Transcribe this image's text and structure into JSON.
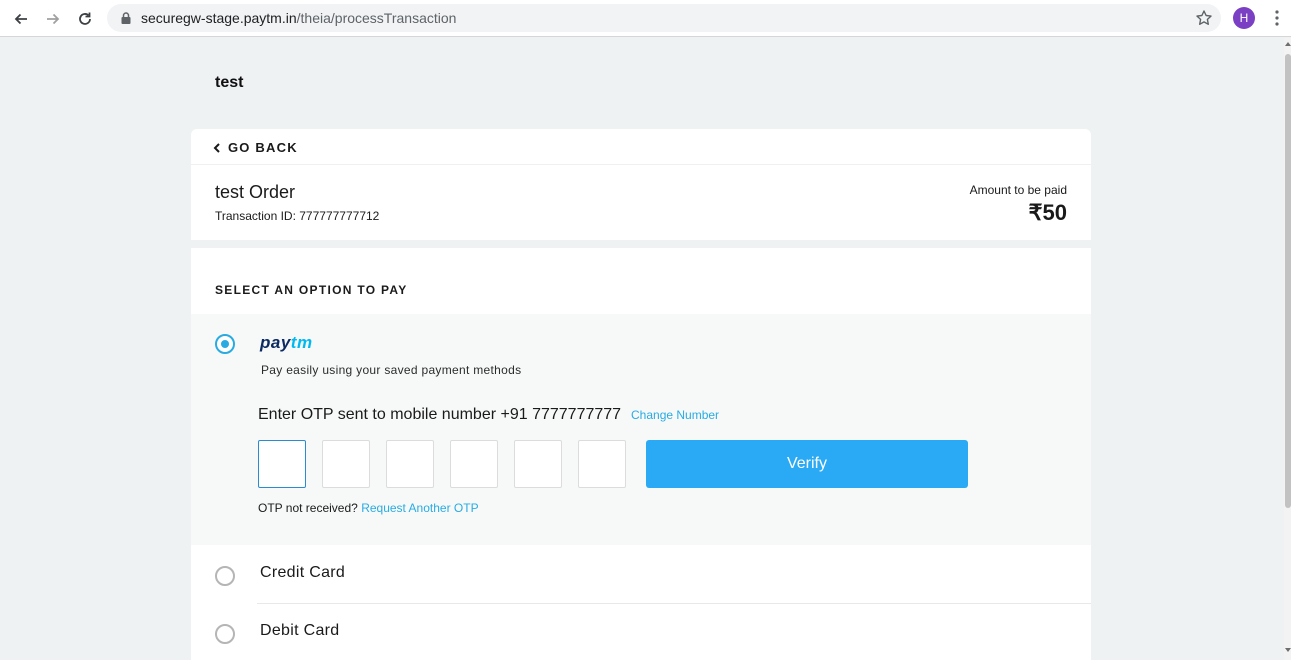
{
  "browser": {
    "url_host": "securegw-stage.paytm.in",
    "url_path": "/theia/processTransaction",
    "profile_initial": "H"
  },
  "merchant": {
    "name": "test"
  },
  "order": {
    "go_back_label": "GO BACK",
    "title": "test Order",
    "transaction_id": "Transaction ID: 777777777712",
    "amount_label": "Amount to be paid",
    "amount": "₹50"
  },
  "payment": {
    "section_title": "SELECT AN OPTION TO PAY",
    "paytm": {
      "logo_pay": "pay",
      "logo_tm": "tm",
      "description": "Pay easily using your saved payment methods",
      "otp_prompt": "Enter OTP sent to mobile number +91 7777777777",
      "change_number": "Change Number",
      "otp_digits": [
        "",
        "",
        "",
        "",
        "",
        ""
      ],
      "verify_label": "Verify",
      "otp_not_received": "OTP not received?",
      "request_another": "Request Another OTP"
    },
    "methods": [
      {
        "label": "Credit Card",
        "selected": false
      },
      {
        "label": "Debit Card",
        "selected": false
      }
    ]
  },
  "colors": {
    "accent": "#29abe2",
    "verify_button": "#2aaaf5",
    "paytm_dark": "#0b2a62",
    "paytm_light": "#00b9f1"
  }
}
